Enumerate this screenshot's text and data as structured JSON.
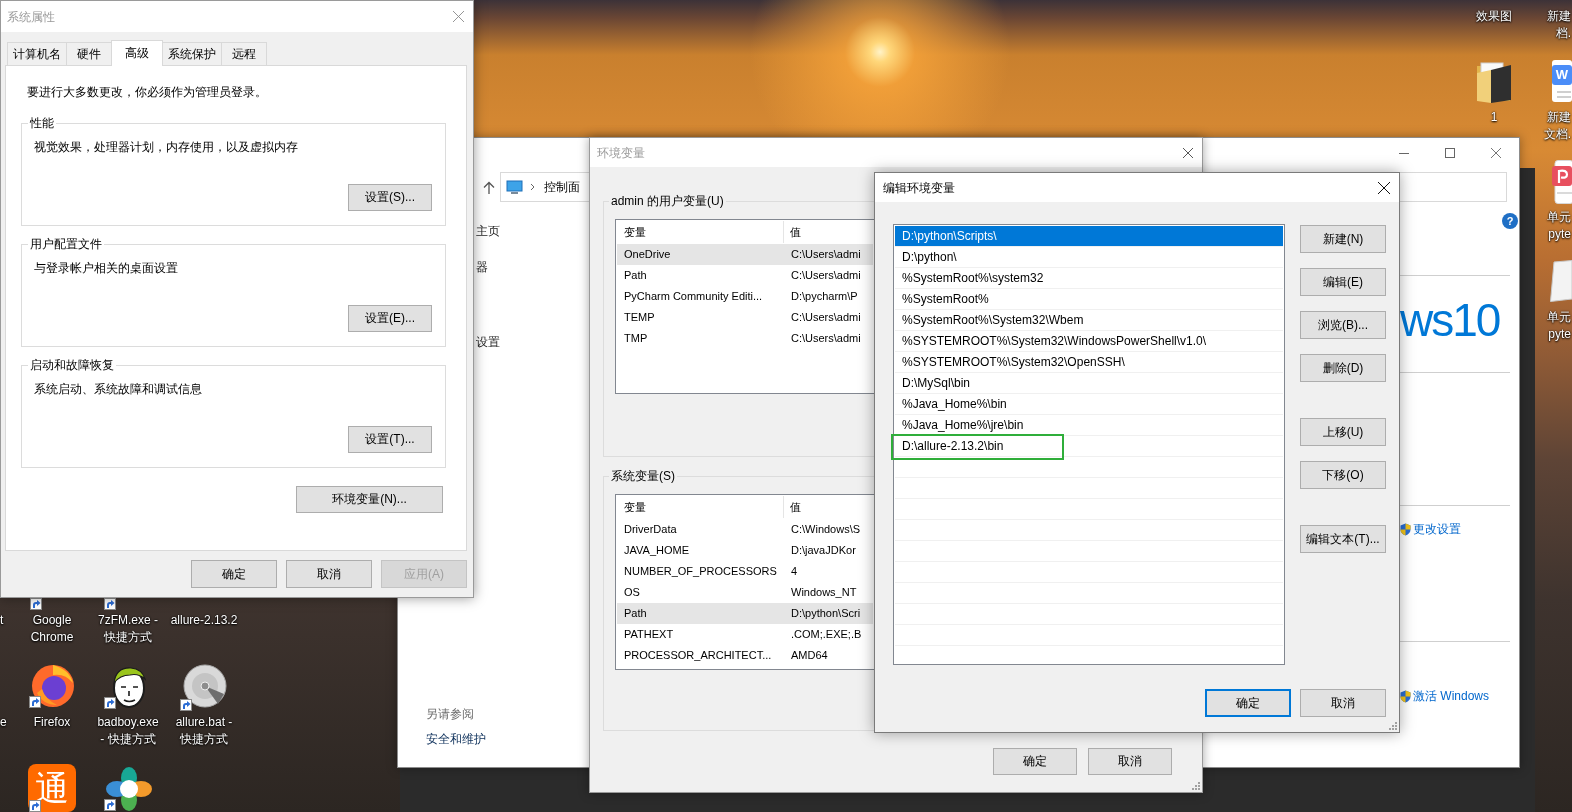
{
  "system_properties": {
    "title": "系统属性",
    "tabs": [
      {
        "label": "计算机名",
        "selected": false
      },
      {
        "label": "硬件",
        "selected": false
      },
      {
        "label": "高级",
        "selected": true
      },
      {
        "label": "系统保护",
        "selected": false
      },
      {
        "label": "远程",
        "selected": false
      }
    ],
    "notice": "要进行大多数更改，你必须作为管理员登录。",
    "groups": [
      {
        "title": "性能",
        "description": "视觉效果，处理器计划，内存使用，以及虚拟内存",
        "button": "设置(S)..."
      },
      {
        "title": "用户配置文件",
        "description": "与登录帐户相关的桌面设置",
        "button": "设置(E)..."
      },
      {
        "title": "启动和故障恢复",
        "description": "系统启动、系统故障和调试信息",
        "button": "设置(T)..."
      }
    ],
    "env_button": "环境变量(N)...",
    "buttons": [
      {
        "label": "确定",
        "disabled": false
      },
      {
        "label": "取消",
        "disabled": false
      },
      {
        "label": "应用(A)",
        "disabled": true
      }
    ]
  },
  "control_panel": {
    "address": "控制面",
    "sidebar_links": [
      "主页",
      "器",
      "设置"
    ],
    "see_also": "另请参阅",
    "see_also_links": [
      "安全和维护"
    ],
    "help": "?",
    "edition_text": "ws10",
    "links": [
      "更改设置",
      "激活 Windows"
    ]
  },
  "environment_variables": {
    "title": "环境变量",
    "user_variables": {
      "label": "admin 的用户变量(U)",
      "columns": [
        "变量",
        "值"
      ],
      "rows": [
        {
          "name": "OneDrive",
          "value": "C:\\Users\\admi",
          "selected": true
        },
        {
          "name": "Path",
          "value": "C:\\Users\\admi",
          "selected": false
        },
        {
          "name": "PyCharm Community Editi...",
          "value": "D:\\pycharm\\P",
          "selected": false
        },
        {
          "name": "TEMP",
          "value": "C:\\Users\\admi",
          "selected": false
        },
        {
          "name": "TMP",
          "value": "C:\\Users\\admi",
          "selected": false
        }
      ]
    },
    "system_variables": {
      "label": "系统变量(S)",
      "columns": [
        "变量",
        "值"
      ],
      "rows": [
        {
          "name": "DriverData",
          "value": "C:\\Windows\\S",
          "selected": false
        },
        {
          "name": "JAVA_HOME",
          "value": "D:\\javaJDKor",
          "selected": false
        },
        {
          "name": "NUMBER_OF_PROCESSORS",
          "value": "4",
          "selected": false
        },
        {
          "name": "OS",
          "value": "Windows_NT",
          "selected": false
        },
        {
          "name": "Path",
          "value": "D:\\python\\Scri",
          "selected": true
        },
        {
          "name": "PATHEXT",
          "value": ".COM;.EXE;.B",
          "selected": false
        },
        {
          "name": "PROCESSOR_ARCHITECT...",
          "value": "AMD64",
          "selected": false
        }
      ]
    },
    "buttons": [
      "确定",
      "取消"
    ]
  },
  "edit_environment_variable": {
    "title": "编辑环境变量",
    "entries": [
      {
        "text": "D:\\python\\Scripts\\",
        "selected": true,
        "highlighted": false
      },
      {
        "text": "D:\\python\\",
        "selected": false,
        "highlighted": false
      },
      {
        "text": "%SystemRoot%\\system32",
        "selected": false,
        "highlighted": false
      },
      {
        "text": "%SystemRoot%",
        "selected": false,
        "highlighted": false
      },
      {
        "text": "%SystemRoot%\\System32\\Wbem",
        "selected": false,
        "highlighted": false
      },
      {
        "text": "%SYSTEMROOT%\\System32\\WindowsPowerShell\\v1.0\\",
        "selected": false,
        "highlighted": false
      },
      {
        "text": "%SYSTEMROOT%\\System32\\OpenSSH\\",
        "selected": false,
        "highlighted": false
      },
      {
        "text": "D:\\MySql\\bin",
        "selected": false,
        "highlighted": false
      },
      {
        "text": "%Java_Home%\\bin",
        "selected": false,
        "highlighted": false
      },
      {
        "text": "%Java_Home%\\jre\\bin",
        "selected": false,
        "highlighted": false
      },
      {
        "text": "D:\\allure-2.13.2\\bin",
        "selected": false,
        "highlighted": true
      }
    ],
    "button_groups": [
      [
        "新建(N)",
        "编辑(E)",
        "浏览(B)...",
        "删除(D)"
      ],
      [
        "上移(U)",
        "下移(O)"
      ],
      [
        "编辑文本(T)..."
      ]
    ],
    "buttons": [
      {
        "label": "确定",
        "default": true
      },
      {
        "label": "取消",
        "default": false
      }
    ]
  },
  "desktop": {
    "icons": [
      {
        "label": "效果图",
        "kind": "none"
      },
      {
        "label": "新建档.",
        "kind": "none"
      },
      {
        "label": "1",
        "kind": "folder"
      },
      {
        "label": "新建文档.",
        "kind": "word",
        "glyph": "W"
      },
      {
        "label": "单元\npyte",
        "kind": "pdf"
      },
      {
        "label": "单元\npyte",
        "kind": "page"
      },
      {
        "label": "t",
        "kind": "none"
      },
      {
        "label": "Google\nChrome",
        "kind": "covered"
      },
      {
        "label": "7zFM.exe -\n快捷方式",
        "kind": "covered"
      },
      {
        "label": "allure-2.13.2",
        "kind": "none"
      },
      {
        "label": "e",
        "kind": "none"
      },
      {
        "label": "Firefox",
        "kind": "fox"
      },
      {
        "label": "badboy.exe\n- 快捷方式",
        "kind": "cartoon"
      },
      {
        "label": "allure.bat -\n快捷方式",
        "kind": "disc"
      },
      {
        "kind": "tile",
        "glyph": "通"
      },
      {
        "kind": "flower"
      }
    ]
  }
}
